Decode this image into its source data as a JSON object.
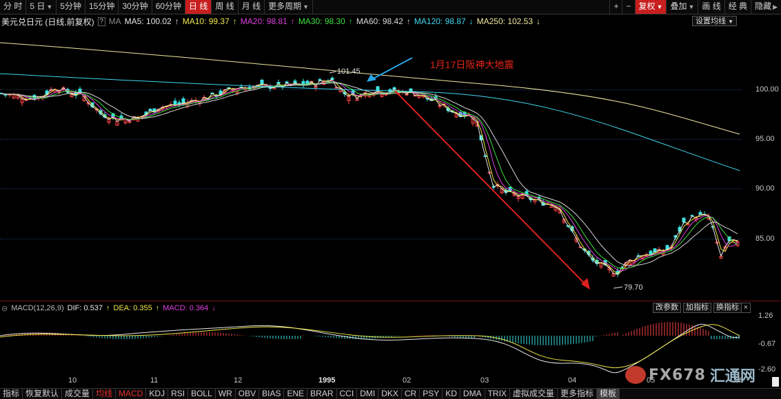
{
  "toolbar": {
    "left": [
      {
        "label": "分 时"
      },
      {
        "label": "5 日",
        "dropdown": true
      },
      {
        "label": "5分钟"
      },
      {
        "label": "15分钟"
      },
      {
        "label": "30分钟"
      },
      {
        "label": "60分钟"
      },
      {
        "label": "日 线",
        "active": true
      },
      {
        "label": "周 线"
      },
      {
        "label": "月 线"
      },
      {
        "label": "更多周期",
        "dropdown": true
      }
    ],
    "right": [
      {
        "label": "+"
      },
      {
        "label": "−"
      },
      {
        "label": "复权",
        "dropdown": true,
        "active": true
      },
      {
        "label": "叠加",
        "dropdown": true
      },
      {
        "label": "画 线"
      },
      {
        "label": "经 典"
      },
      {
        "label": "隐藏",
        "dropdown": true
      }
    ]
  },
  "ma_row": {
    "title": "美元兑日元 (日线,前复权)",
    "help": "?",
    "ma_label": "MA",
    "items": [
      {
        "text": "MA5: 100.02",
        "color": "#e8e8e8"
      },
      {
        "text": "MA10: 99.37",
        "color": "#f2e84a"
      },
      {
        "text": "MA20: 98.81",
        "color": "#e040e0"
      },
      {
        "text": "MA30: 98.30",
        "color": "#40e040"
      },
      {
        "text": "MA60: 98.42",
        "color": "#d8d8d8"
      },
      {
        "text": "MA120: 98.87",
        "color": "#40d8f0"
      },
      {
        "text": "MA250: 102.53",
        "color": "#f0e8a0"
      }
    ],
    "set_ma": "设置均线"
  },
  "price_axis": [
    "100.00",
    "95.00",
    "90.00",
    "85.00"
  ],
  "annotation": "1月17日阪神大地震",
  "high_tag": "101.45",
  "low_tag": "79.70",
  "macd": {
    "title": "MACD(12,26,9)",
    "dif": "DIF: 0.537",
    "dea": "DEA: 0.355",
    "macd": "MACD: 0.364",
    "buttons": [
      "改参数",
      "加指标",
      "换指标"
    ],
    "close": "×",
    "axis": [
      "1.26",
      "-0.67",
      "-2.60"
    ]
  },
  "date_axis": [
    "10",
    "11",
    "12",
    "1995",
    "02",
    "03",
    "04",
    "05",
    "06"
  ],
  "tabs": [
    {
      "label": "指标"
    },
    {
      "label": "恢复默认"
    },
    {
      "label": "成交量"
    },
    {
      "label": "均线",
      "red": true
    },
    {
      "label": "MACD",
      "red": true
    },
    {
      "label": "KDJ"
    },
    {
      "label": "RSI"
    },
    {
      "label": "BOLL"
    },
    {
      "label": "WR"
    },
    {
      "label": "OBV"
    },
    {
      "label": "BIAS"
    },
    {
      "label": "ENE"
    },
    {
      "label": "BRAR"
    },
    {
      "label": "CCI"
    },
    {
      "label": "DMI"
    },
    {
      "label": "DKX"
    },
    {
      "label": "CR"
    },
    {
      "label": "PSY"
    },
    {
      "label": "KD"
    },
    {
      "label": "DMA"
    },
    {
      "label": "TRIX"
    },
    {
      "label": "虚拟成交量"
    },
    {
      "label": "更多指标"
    },
    {
      "label": "模板",
      "gray": true
    }
  ],
  "watermark": {
    "latin": "FX678",
    "cn": "汇通网"
  }
}
